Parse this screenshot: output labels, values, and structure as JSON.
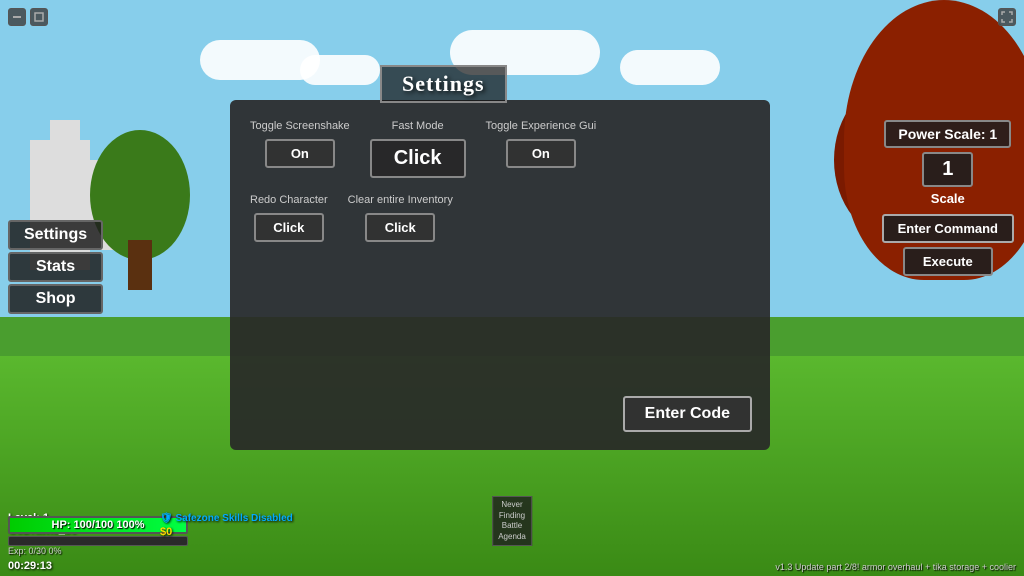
{
  "window": {
    "title": "Settings",
    "fullscreen_icon": "⛶"
  },
  "settings_panel": {
    "title": "Settings",
    "row1": {
      "toggle_screenshake": {
        "label": "Toggle Screenshake",
        "value": "On"
      },
      "fast_mode": {
        "label": "Fast Mode",
        "value": "Click"
      },
      "toggle_experience": {
        "label": "Toggle Experience Gui",
        "value": "On"
      }
    },
    "row2": {
      "redo_character": {
        "label": "Redo Character",
        "value": "Click"
      },
      "clear_inventory": {
        "label": "Clear entire Inventory",
        "value": "Click"
      }
    },
    "enter_code_btn": "Enter Code"
  },
  "sidebar": {
    "items": [
      "Settings",
      "Stats",
      "Shop"
    ]
  },
  "right_panel": {
    "power_scale_label": "Power Scale: 1",
    "power_scale_value": "1",
    "scale_label": "Scale",
    "enter_command_btn": "Enter Command",
    "execute_btn": "Execute"
  },
  "hud": {
    "level": "Level: 1",
    "player_name": "GsDrawls_99",
    "hp_text": "HP: 100/100 100%",
    "exp_text": "Exp: 0/30 0%",
    "timer": "00:29:13",
    "safezone": "🛡 Safezone Skills\nDisabled",
    "money": "$0",
    "never_finding_battle": "Never\nFinding\nBattle\nAgenda",
    "version": "v1.3 Update part 2/8! armor overhaul + tika storage + coolier"
  }
}
